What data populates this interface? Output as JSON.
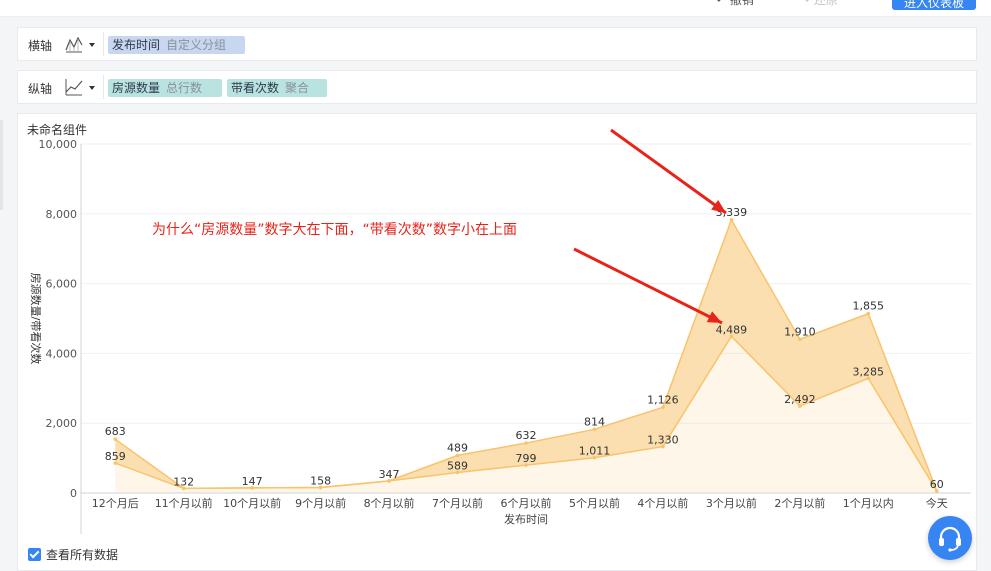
{
  "toolbar": {
    "undo_label": "撤销",
    "redo_label": "还原",
    "enter_label": "进入仪表板"
  },
  "axis_config": {
    "x": {
      "label": "横轴",
      "field": "发布时间",
      "setting": "自定义分组"
    },
    "y": {
      "label": "纵轴",
      "fields": [
        {
          "field": "房源数量",
          "setting": "总行数"
        },
        {
          "field": "带看次数",
          "setting": "聚合"
        }
      ]
    }
  },
  "chart_title": "未命名组件",
  "annotation_text": "为什么“房源数量”数字大在下面，“带看次数”数字小在上面",
  "footer": {
    "show_all_label": "查看所有数据"
  },
  "colors": {
    "area_fill": "#fbdca7",
    "area_line": "#f9c36b",
    "annotation": "#e8231a",
    "accent": "#3685f2"
  },
  "chart_data": {
    "type": "area",
    "categories": [
      "12个月后",
      "11个月以前",
      "10个月以前",
      "9个月以前",
      "8个月以前",
      "7个月以前",
      "6个月以前",
      "5个月以前",
      "4个月以前",
      "3个月以前",
      "2个月以前",
      "1个月以内",
      "今天"
    ],
    "series": [
      {
        "values": [
          859,
          132,
          147,
          158,
          347,
          589,
          799,
          1011,
          1330,
          4489,
          2492,
          3285,
          60
        ]
      },
      {
        "values": [
          683,
          0,
          0,
          0,
          0,
          489,
          632,
          814,
          1126,
          3339,
          1910,
          1855,
          0
        ]
      }
    ],
    "stacked": true,
    "value_labels": [
      [
        {
          "i": 0,
          "text": "859"
        },
        {
          "i": 1,
          "text": "132"
        },
        {
          "i": 2,
          "text": "147"
        },
        {
          "i": 3,
          "text": "158"
        },
        {
          "i": 4,
          "text": "347"
        },
        {
          "i": 5,
          "text": "589"
        },
        {
          "i": 6,
          "text": "799"
        },
        {
          "i": 7,
          "text": "1,011"
        },
        {
          "i": 8,
          "text": "1,330"
        },
        {
          "i": 9,
          "text": "4,489"
        },
        {
          "i": 10,
          "text": "2,492"
        },
        {
          "i": 11,
          "text": "3,285"
        },
        {
          "i": 12,
          "text": "60"
        }
      ],
      [
        {
          "i": 0,
          "text": "683"
        },
        {
          "i": 5,
          "text": "489"
        },
        {
          "i": 6,
          "text": "632"
        },
        {
          "i": 7,
          "text": "814"
        },
        {
          "i": 8,
          "text": "1,126"
        },
        {
          "i": 9,
          "text": "3,339"
        },
        {
          "i": 10,
          "text": "1,910"
        },
        {
          "i": 11,
          "text": "1,855"
        }
      ]
    ],
    "xlabel": "发布时间",
    "ylabel": "房源数量/带看次数",
    "ylim": [
      0,
      10000
    ],
    "yticks": [
      0,
      2000,
      4000,
      6000,
      8000,
      10000
    ],
    "ytick_labels": [
      "0",
      "2,000",
      "4,000",
      "6,000",
      "8,000",
      "10,000"
    ],
    "grid": true,
    "legend": "none"
  }
}
